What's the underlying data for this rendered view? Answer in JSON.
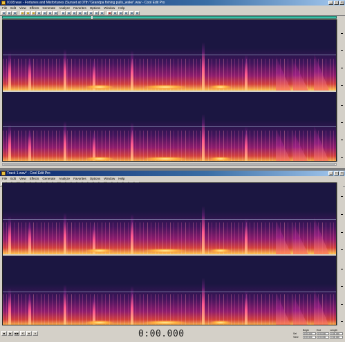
{
  "windows": [
    {
      "title": "0108.wav - Fortunes and Misfortunes (Sunset at 07th \"Grandpa fishing pulls_wake\".wav - Cool Edit Pro",
      "menu": [
        "File",
        "Edit",
        "View",
        "Effects",
        "Generate",
        "Analyze",
        "Favorites",
        "Options",
        "Window",
        "Help"
      ]
    },
    {
      "title": "Track 1.wav* - Cool Edit Pro",
      "menu": [
        "File",
        "Edit",
        "View",
        "Effects",
        "Generate",
        "Analyze",
        "Favorites",
        "Options",
        "Window",
        "Help"
      ]
    }
  ],
  "window_buttons": {
    "minimize": "_",
    "maximize": "□",
    "close": "×"
  },
  "transport": [
    "■",
    "▶",
    "▶▶",
    "⟲",
    "●",
    "⏸"
  ],
  "time_display": "0:00.000",
  "selection_panel": {
    "headers": [
      "Begin",
      "End",
      "Length"
    ],
    "rows": [
      "Sel",
      "View"
    ],
    "values": [
      "0:00.000",
      "0:00.000",
      "0:00.000"
    ]
  },
  "colors": {
    "spectro_bg": "#1b1641",
    "overview": "#39c2a8",
    "title_gradient_start": "#0a246a"
  },
  "icons": [
    "app-icon",
    "minimize-icon",
    "maximize-icon",
    "close-icon"
  ]
}
